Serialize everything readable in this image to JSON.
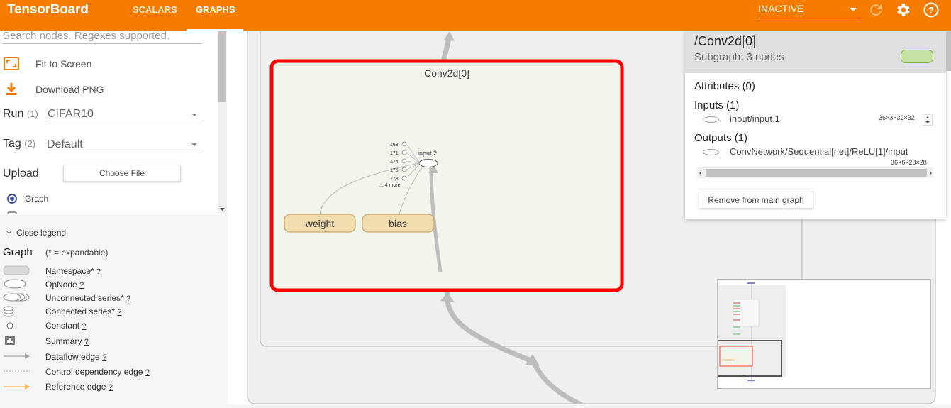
{
  "app": {
    "title": "TensorBoard"
  },
  "tabs": [
    {
      "label": "SCALARS",
      "active": false
    },
    {
      "label": "GRAPHS",
      "active": true
    }
  ],
  "topbar": {
    "status_select": "INACTIVE",
    "accent_color": "#f57c00",
    "icons": [
      "refresh-icon",
      "settings-icon",
      "help-icon"
    ]
  },
  "sidebar": {
    "search_placeholder": "Search nodes. Regexes supported.",
    "fit_label": "Fit to Screen",
    "download_label": "Download PNG",
    "run": {
      "label": "Run",
      "count": "(1)",
      "value": "CIFAR10"
    },
    "tag": {
      "label": "Tag",
      "count": "(2)",
      "value": "Default"
    },
    "upload": {
      "label": "Upload",
      "button": "Choose File"
    },
    "radio_graph": "Graph"
  },
  "legend": {
    "close_label": "Close legend.",
    "title": "Graph",
    "subtitle": "(* = expandable)",
    "items": [
      {
        "label": "Namespace*",
        "help": "?"
      },
      {
        "label": "OpNode",
        "help": "?"
      },
      {
        "label": "Unconnected series*",
        "help": "?"
      },
      {
        "label": "Connected series*",
        "help": "?"
      },
      {
        "label": "Constant",
        "help": "?"
      },
      {
        "label": "Summary",
        "help": "?"
      },
      {
        "label": "Dataflow edge",
        "help": "?"
      },
      {
        "label": "Control dependency edge",
        "help": "?"
      },
      {
        "label": "Reference edge",
        "help": "?"
      }
    ]
  },
  "graph": {
    "selected_node": "Conv2d[0]",
    "op_node": "input.2",
    "series_nodes": [
      "168",
      "171",
      "174",
      "175",
      "178",
      "... 4 more"
    ],
    "const_nodes": [
      "weight",
      "bias"
    ],
    "selection_color": "#f00"
  },
  "info_card": {
    "title": "/Conv2d[0]",
    "subtitle": "Subgraph: 3 nodes",
    "attributes": "Attributes (0)",
    "inputs": "Inputs (1)",
    "input_item": "input/input.1",
    "input_shape": "36×3×32×32",
    "outputs": "Outputs (1)",
    "output_item": "ConvNetwork/Sequential[net]/ReLU[1]/input",
    "output_shape": "36×6×28×28",
    "remove_button": "Remove from main graph"
  }
}
